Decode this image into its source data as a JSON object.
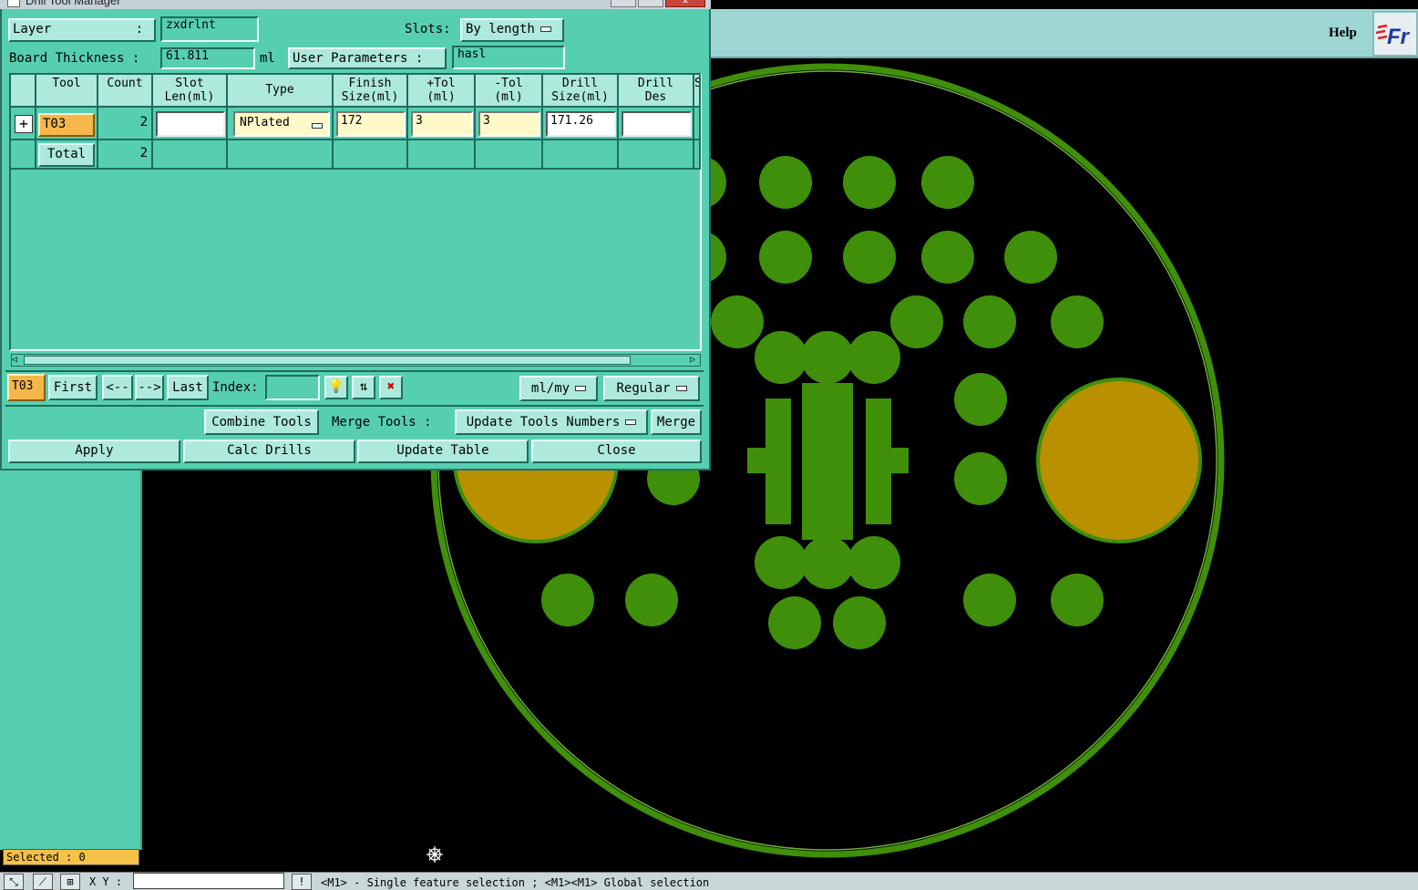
{
  "window": {
    "title": "Drill Tool Manager"
  },
  "header": {
    "layer_label": "Layer",
    "layer_colon": ":",
    "layer_value": "zxdrlnt",
    "slots_label": "Slots:",
    "slots_value": "By length",
    "board_thickness_label": "Board Thickness :",
    "board_thickness_value": "61.811",
    "board_thickness_unit": "ml",
    "user_params_label": "User Parameters :",
    "user_params_value": "hasl"
  },
  "table": {
    "columns": [
      {
        "line1": "Tool",
        "line2": ""
      },
      {
        "line1": "Count",
        "line2": ""
      },
      {
        "line1": "Slot",
        "line2": "Len(ml)"
      },
      {
        "line1": "Type",
        "line2": ""
      },
      {
        "line1": "Finish",
        "line2": "Size(ml)"
      },
      {
        "line1": "+Tol",
        "line2": "(ml)"
      },
      {
        "line1": "-Tol",
        "line2": "(ml)"
      },
      {
        "line1": "Drill",
        "line2": "Size(ml)"
      },
      {
        "line1": "Drill",
        "line2": "Des"
      },
      {
        "line1": "S",
        "line2": ""
      }
    ],
    "rows": [
      {
        "tool": "T03",
        "count": "2",
        "slot_len": "",
        "type": "NPlated",
        "finish_size": "172",
        "plus_tol": "3",
        "minus_tol": "3",
        "drill_size": "171.26",
        "drill_des": ""
      }
    ],
    "total": {
      "label": "Total",
      "count": "2"
    }
  },
  "nav": {
    "current_tool": "T03",
    "first": "First",
    "prev": "<--",
    "next": "-->",
    "last": "Last",
    "index_label": "Index:",
    "index_value": "",
    "units": "ml/my",
    "mode": "Regular"
  },
  "actions": {
    "combine_tools": "Combine Tools",
    "merge_tools_label": "Merge Tools :",
    "merge_mode": "Update Tools Numbers",
    "merge": "Merge",
    "apply": "Apply",
    "calc_drills": "Calc Drills",
    "update_table": "Update Table",
    "close": "Close"
  },
  "app": {
    "help": "Help",
    "logo_text": "Fr",
    "selected": "Selected : 0",
    "xy_label": "X Y :",
    "xy_value": "",
    "status_message": "<M1> - Single feature selection ; <M1><M1> Global selection"
  },
  "colors": {
    "dialog_bg": "#56cfb0",
    "pad_green": "#3f8f0a",
    "drill_gold": "#b89000",
    "canvas_bg": "#000000",
    "tool_highlight": "#f6b74a"
  }
}
